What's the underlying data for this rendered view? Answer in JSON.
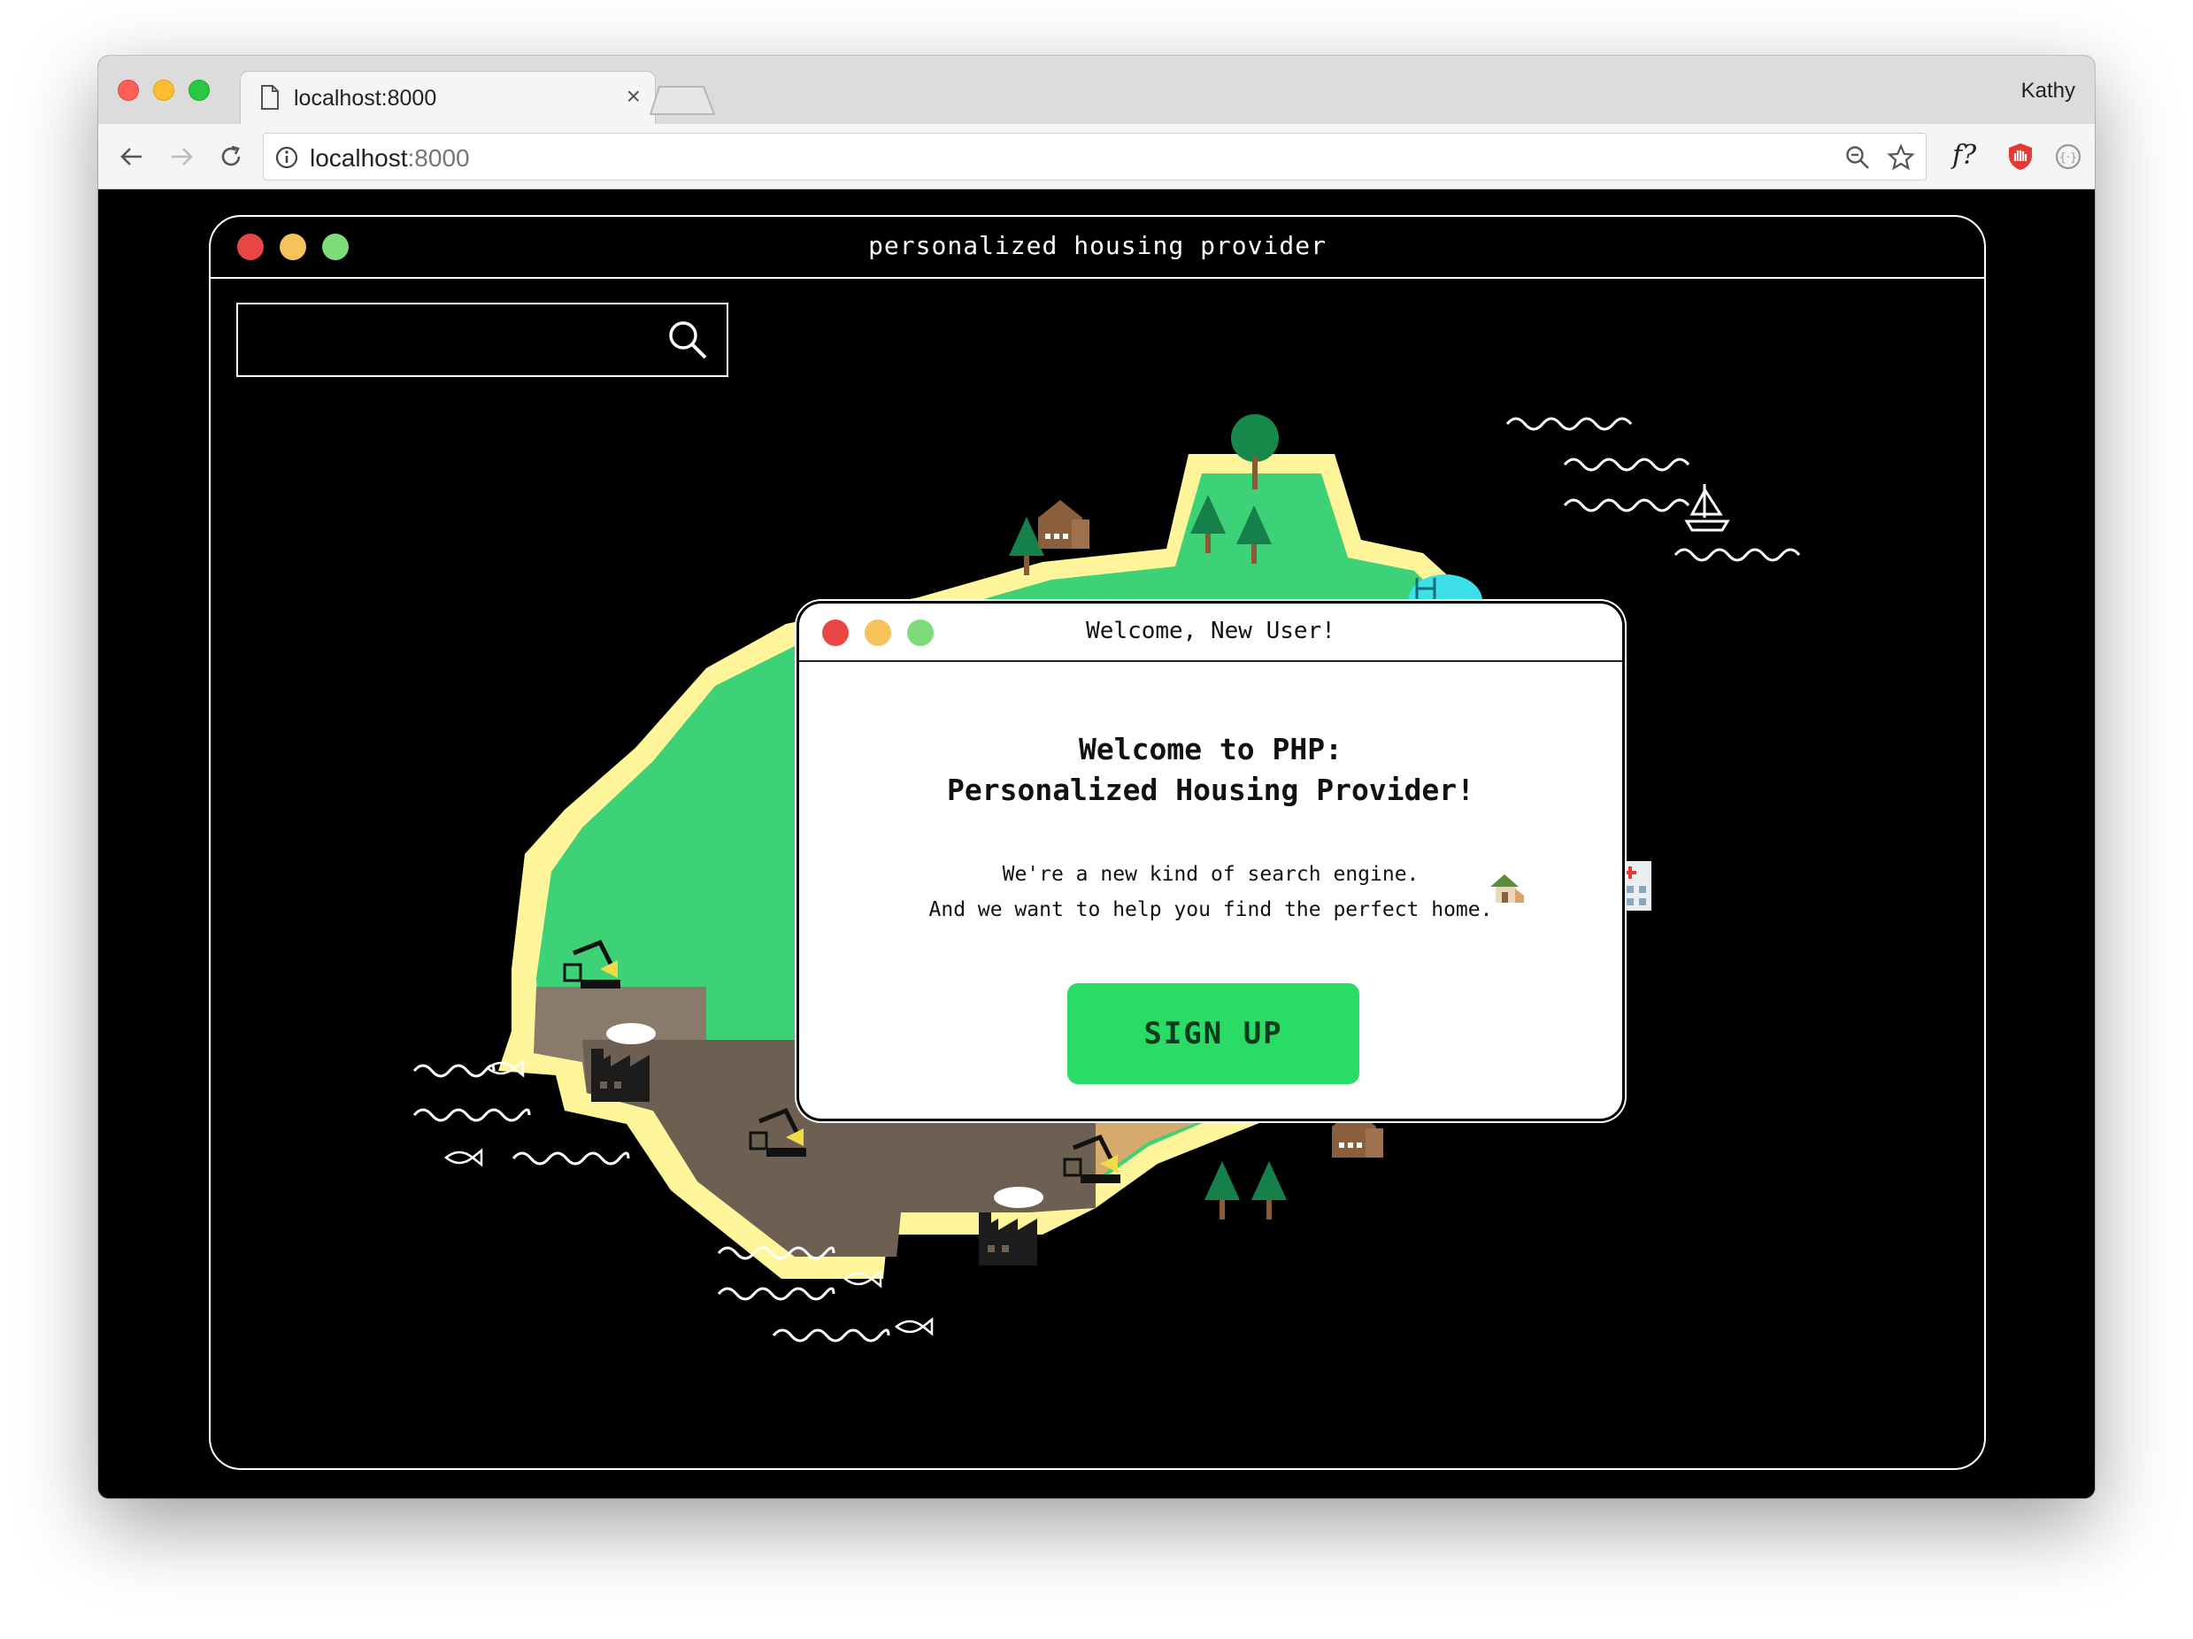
{
  "browser": {
    "tab_title": "localhost:8000",
    "tab_close": "×",
    "profile_name": "Kathy",
    "url_host": "localhost",
    "url_port": ":8000",
    "extension_label": "f?"
  },
  "app": {
    "title": "personalized housing provider",
    "search": {
      "value": "",
      "placeholder": ""
    }
  },
  "dialog": {
    "title": "Welcome, New User!",
    "heading_line1": "Welcome to PHP:",
    "heading_line2": "Personalized Housing Provider!",
    "body_line1": "We're a new kind of search engine.",
    "body_line2": "And we want to help you find the perfect home.",
    "signup_label": "SIGN UP"
  },
  "colors": {
    "traffic_red": "#ff5f57",
    "traffic_yellow": "#febc2e",
    "traffic_green": "#28c840",
    "app_dot_red": "#e84545",
    "app_dot_yellow": "#f5c35a",
    "app_dot_green": "#7ddc7a",
    "signup_green": "#2adb66",
    "shore_yellow": "#fff59a",
    "grass_green": "#3dd277",
    "meadow_green": "#8fe084",
    "sand": "#d6a96c",
    "dirt_brown": "#6e5f53"
  },
  "icons": [
    "doc-icon",
    "back-icon",
    "forward-icon",
    "reload-icon",
    "info-icon",
    "zoom-icon",
    "star-icon",
    "shield-icon",
    "extension-icon",
    "menu-icon",
    "search-icon",
    "house-icon",
    "crane-icon",
    "factory-icon",
    "tree-icon",
    "fish-icon",
    "sailboat-icon",
    "pool-icon",
    "hospital-icon",
    "apartment-icon"
  ]
}
